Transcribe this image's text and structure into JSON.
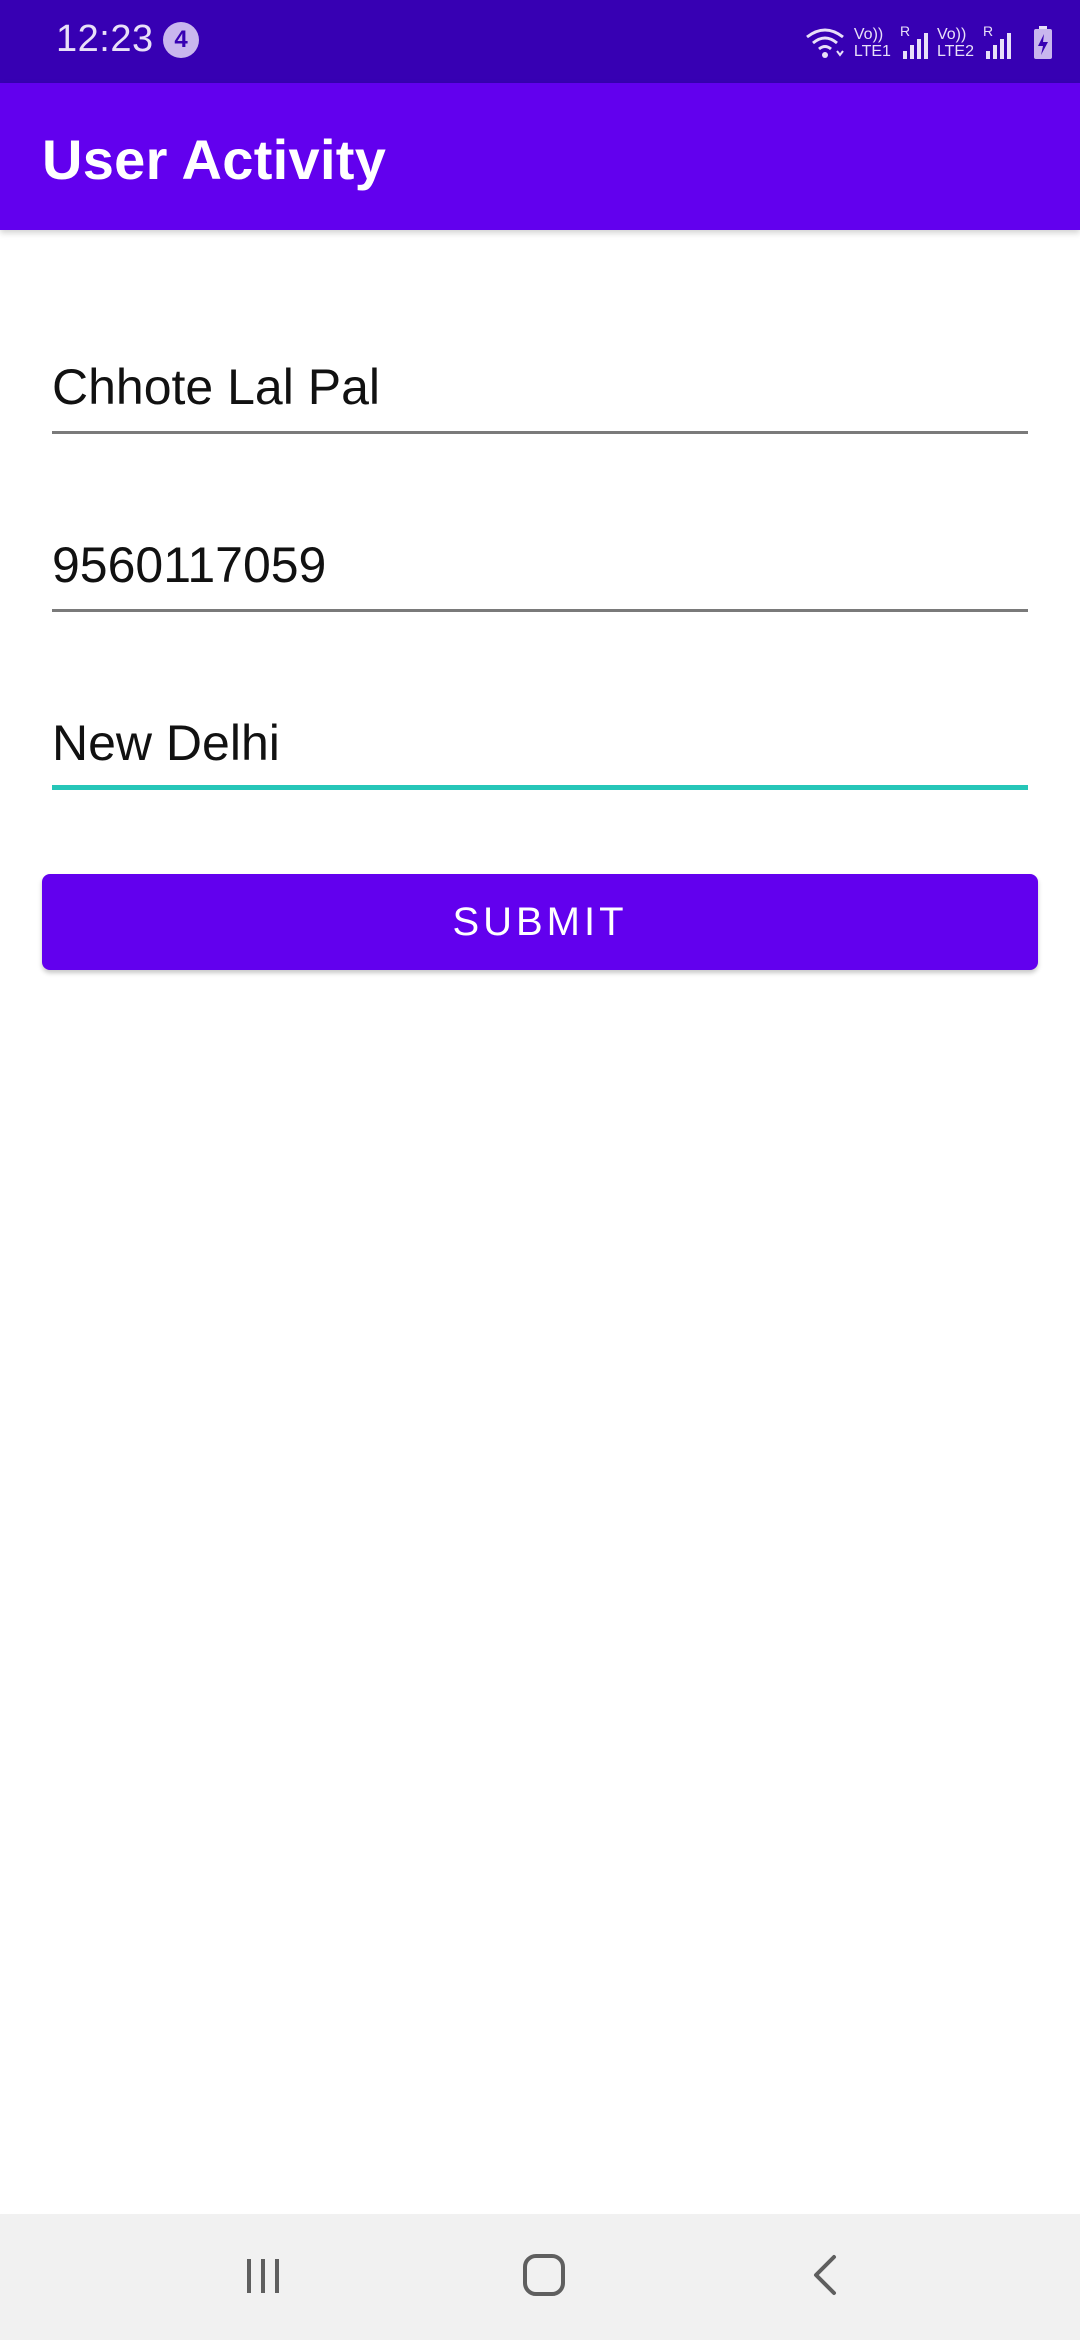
{
  "status_bar": {
    "time": "12:23",
    "notification_count": "4",
    "sim1_label": "Vo)) R\nLTE1",
    "sim1_top": "Vo))",
    "sim1_bottom": "LTE1",
    "sim2_top": "Vo))",
    "sim2_bottom": "LTE2",
    "roaming_indicator": "R",
    "icons": [
      "wifi-icon",
      "signal-icon",
      "signal-icon",
      "battery-charging-icon"
    ]
  },
  "app_bar": {
    "title": "User Activity"
  },
  "form": {
    "name_value": "Chhote Lal Pal",
    "phone_value": "9560117059",
    "city_value": "New Delhi",
    "submit_label": "SUBMIT"
  },
  "nav_bar": {
    "icons": [
      "recents-icon",
      "home-icon",
      "back-icon"
    ]
  },
  "colors": {
    "status_bar": "#3700B3",
    "primary": "#6200EE",
    "accent": "#26C6B8",
    "background": "#FFFFFF",
    "nav_bar": "#F1F1F1"
  }
}
